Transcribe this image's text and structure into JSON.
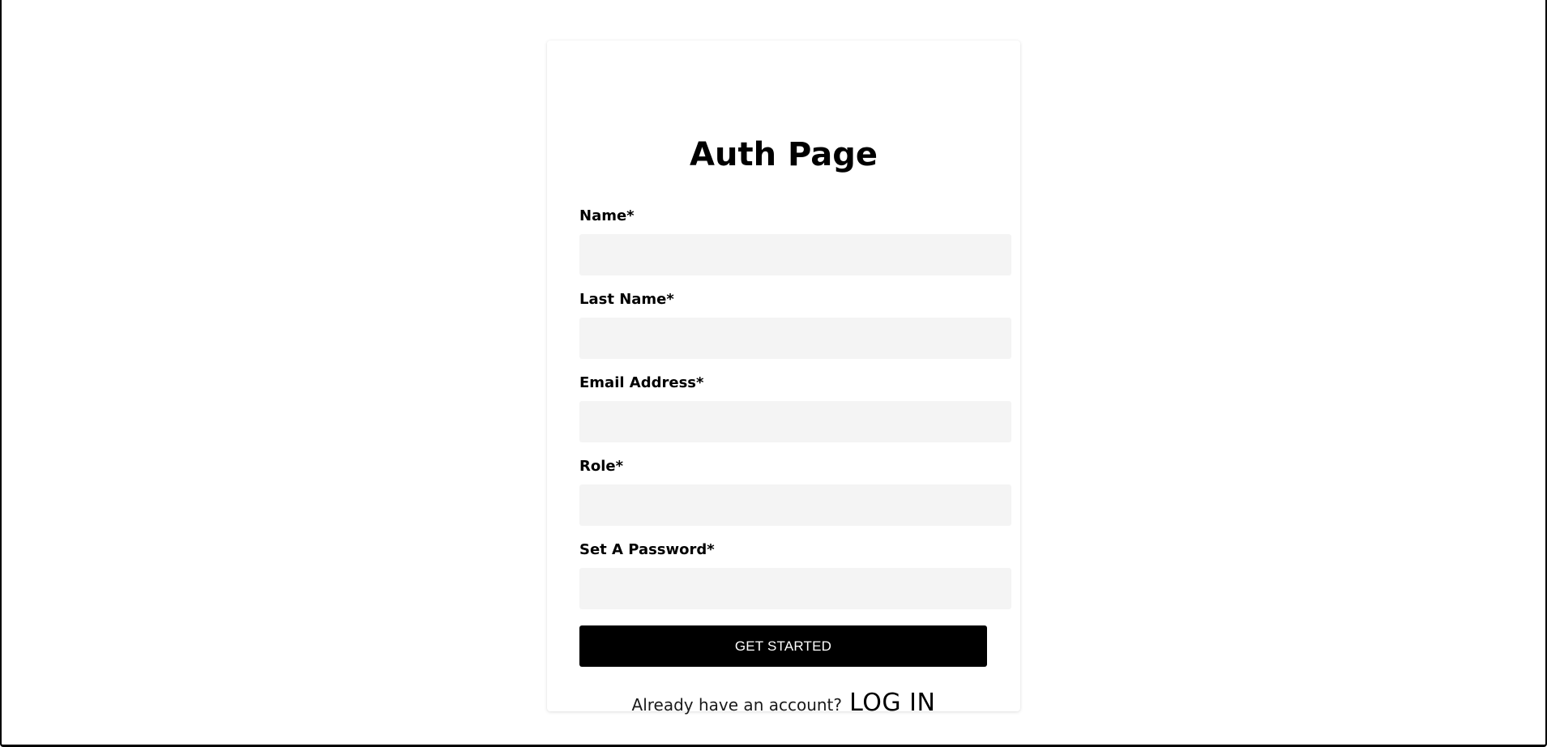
{
  "page": {
    "title": "Auth Page"
  },
  "form": {
    "fields": [
      {
        "label": "Name*",
        "value": "",
        "placeholder": ""
      },
      {
        "label": "Last Name*",
        "value": "",
        "placeholder": ""
      },
      {
        "label": "Email Address*",
        "value": "",
        "placeholder": ""
      },
      {
        "label": "Role*",
        "value": "",
        "placeholder": ""
      },
      {
        "label": "Set A Password*",
        "value": "",
        "placeholder": ""
      }
    ],
    "submit_label": "GET STARTED"
  },
  "footer": {
    "prompt": "Already have an account?",
    "link_label": "LOG IN"
  },
  "colors": {
    "button_bg": "#000000",
    "input_bg": "#f4f4f4",
    "page_bg": "#ffffff"
  }
}
